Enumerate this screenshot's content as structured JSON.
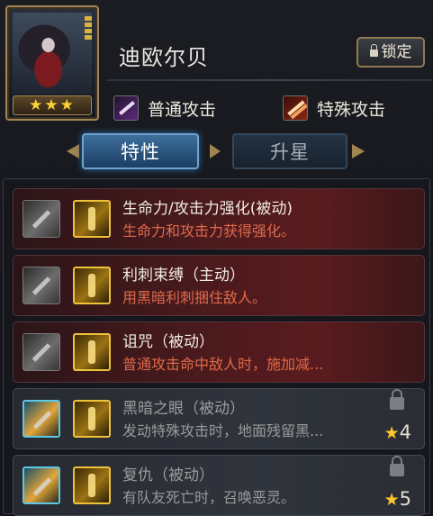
{
  "hero": {
    "name": "迪欧尔贝",
    "stars": "★★★",
    "lock_label": "锁定"
  },
  "attacks": {
    "normal": "普通攻击",
    "special": "特殊攻击"
  },
  "tabs": [
    {
      "label": "特性",
      "active": true
    },
    {
      "label": "升星",
      "active": false
    }
  ],
  "skills": [
    {
      "name": "生命力/攻击力强化(被动)",
      "desc": "生命力和攻击力获得强化。",
      "locked": false
    },
    {
      "name": "利刺束缚（主动）",
      "desc": "用黑暗利刺捆住敌人。",
      "locked": false
    },
    {
      "name": "诅咒（被动）",
      "desc": "普通攻击命中敌人时，施加减...",
      "locked": false
    },
    {
      "name": "黑暗之眼（被动）",
      "desc": "发动特殊攻击时，地面残留黑...",
      "locked": true,
      "required_star": "4"
    },
    {
      "name": "复仇（被动）",
      "desc": "有队友死亡时，召唤恶灵。",
      "locked": true,
      "required_star": "5"
    }
  ],
  "colors": {
    "active_row": "#4a1a1d",
    "locked_row": "#30343c",
    "desc_red": "#e06a4a",
    "star_gold": "#ffc630",
    "tab_active": "#2f5f8c"
  },
  "icons": {
    "normal_attack": "dagger-slash-icon",
    "special_attack": "fire-slash-icon",
    "lock": "padlock-icon"
  }
}
